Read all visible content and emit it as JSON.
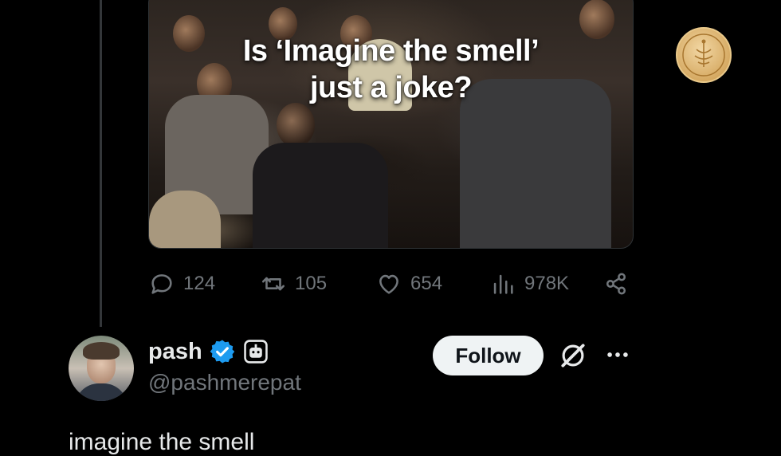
{
  "media": {
    "overlay_line1": "Is ‘Imagine the smell’",
    "overlay_line2": "just a joke?",
    "badge_icon": "gold-seal-logo"
  },
  "actions": {
    "replies": "124",
    "reposts": "105",
    "likes": "654",
    "views": "978K"
  },
  "reply_tweet": {
    "name": "pash",
    "handle": "@pashmerepat",
    "follow_label": "Follow",
    "text": "imagine the smell"
  },
  "colors": {
    "background": "#000000",
    "muted": "#71767b",
    "verified": "#1d9bf0",
    "follow_bg": "#eff3f4"
  }
}
